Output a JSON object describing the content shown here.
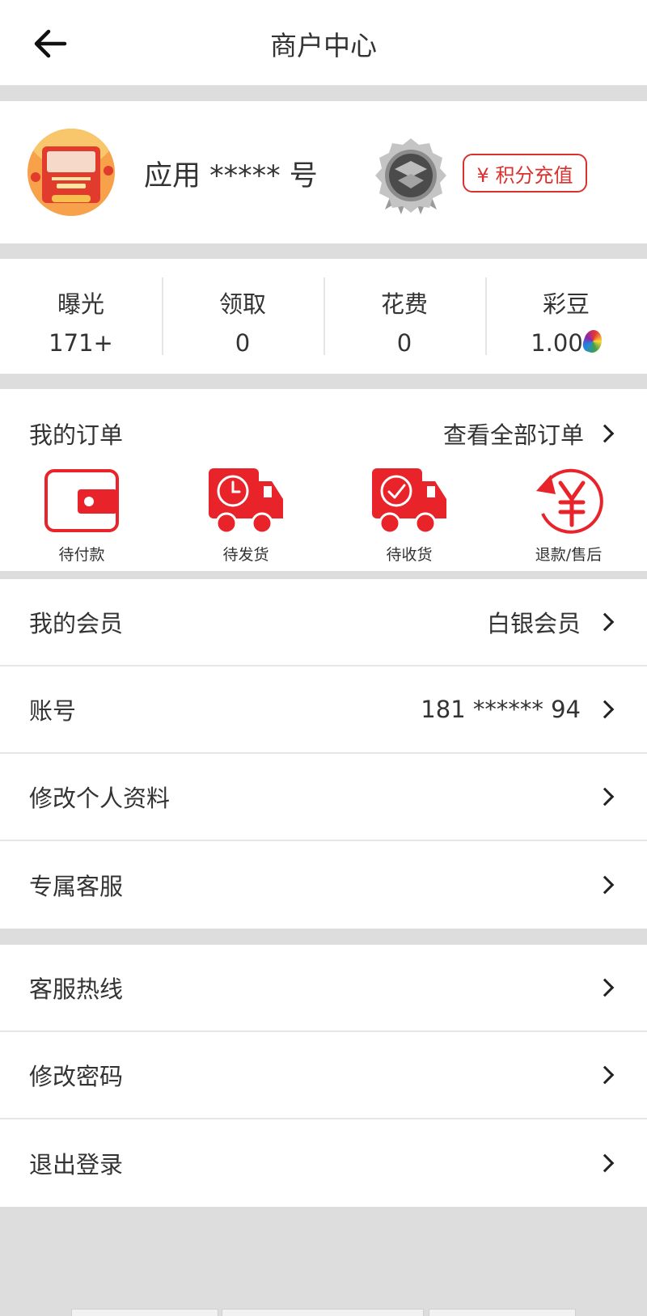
{
  "header": {
    "title": "商户中心"
  },
  "profile": {
    "username": "应用 ***** 号",
    "recharge_label": "¥ 积分充值"
  },
  "stats": [
    {
      "label": "曝光",
      "value": "171+"
    },
    {
      "label": "领取",
      "value": "0"
    },
    {
      "label": "花费",
      "value": "0"
    },
    {
      "label": "彩豆",
      "value": "1.00"
    }
  ],
  "orders": {
    "title": "我的订单",
    "view_all": "查看全部订单",
    "items": [
      {
        "label": "待付款",
        "icon": "wallet-icon"
      },
      {
        "label": "待发货",
        "icon": "truck-clock-icon"
      },
      {
        "label": "待收货",
        "icon": "truck-check-icon"
      },
      {
        "label": "退款/售后",
        "icon": "yen-refund-icon"
      }
    ]
  },
  "menu1": [
    {
      "label": "我的会员",
      "value": "白银会员"
    },
    {
      "label": "账号",
      "value": "181 ****** 94"
    },
    {
      "label": "修改个人资料",
      "value": ""
    },
    {
      "label": "专属客服",
      "value": ""
    }
  ],
  "menu2": [
    {
      "label": "客服热线"
    },
    {
      "label": "修改密码"
    },
    {
      "label": "退出登录"
    }
  ],
  "colors": {
    "accent": "#e8232a",
    "background": "#dddddd"
  }
}
